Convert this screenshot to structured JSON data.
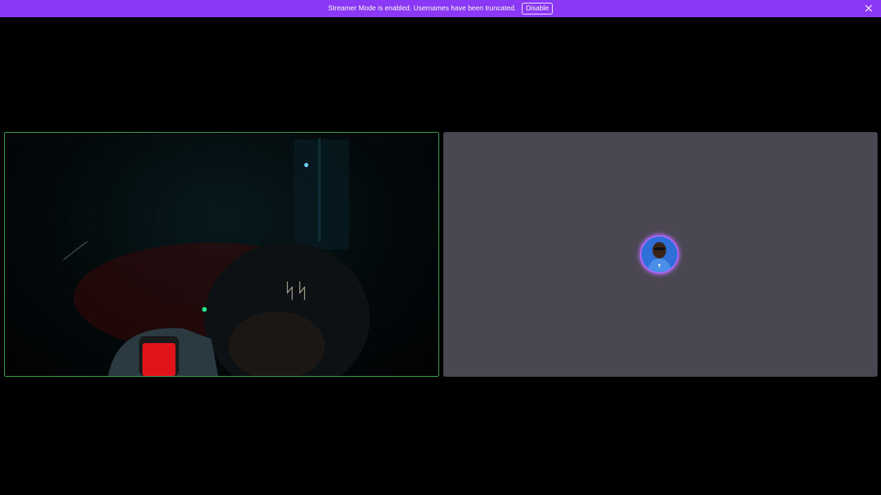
{
  "banner": {
    "message": "Streamer Mode is enabled. Usernames have been truncated.",
    "disable_label": "Disable",
    "close_icon": "close-icon",
    "color": "#8a38f5"
  },
  "tiles": {
    "left": {
      "border_color": "#3fb95f",
      "content": "video-feed"
    },
    "right": {
      "background": "#4a4752",
      "content": "avatar"
    }
  }
}
